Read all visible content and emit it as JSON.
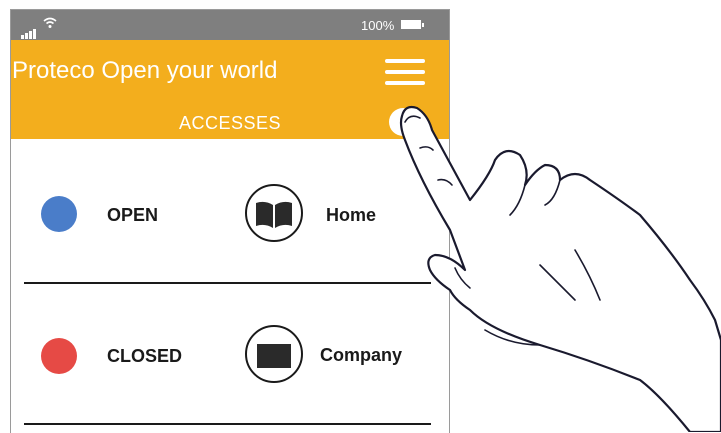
{
  "status_bar": {
    "battery_percent": "100%"
  },
  "header": {
    "app_title": "Proteco Open your world",
    "section_title": "ACCESSES"
  },
  "accesses": [
    {
      "status": "OPEN",
      "status_color": "#4a7dc9",
      "place": "Home",
      "place_icon": "book-icon"
    },
    {
      "status": "CLOSED",
      "status_color": "#e64a45",
      "place": "Company",
      "place_icon": "building-icon"
    }
  ],
  "colors": {
    "header": "#f3ae1d",
    "status_bar": "#7f7f7f"
  }
}
